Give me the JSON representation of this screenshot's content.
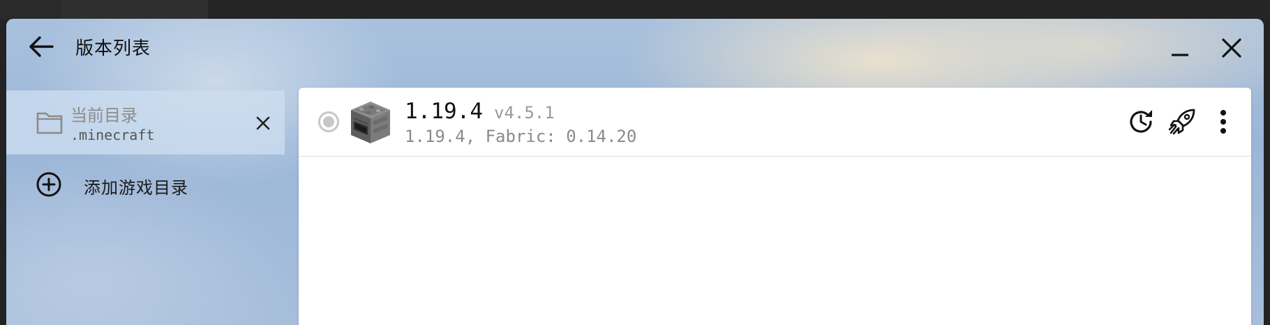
{
  "window": {
    "title": "版本列表"
  },
  "icons": {
    "back": "arrow-left-icon",
    "minimize": "minimize-icon",
    "close": "close-icon",
    "folder": "folder-icon",
    "remove": "close-icon",
    "add": "add-circle-icon",
    "version": "furnace-block-icon",
    "history": "history-icon",
    "launch": "rocket-icon",
    "more": "more-vertical-icon"
  },
  "sidebar": {
    "directories": [
      {
        "name": "当前目录",
        "path": ".minecraft",
        "selected": true
      }
    ],
    "add_label": "添加游戏目录"
  },
  "versions": [
    {
      "name": "1.19.4",
      "tag": "v4.5.1",
      "description": "1.19.4, Fabric: 0.14.20",
      "selected": true
    }
  ],
  "colors": {
    "radio": "#c7c7c7",
    "sidebar_selected_bg": "#cddef0",
    "list_bg": "#ffffff"
  }
}
